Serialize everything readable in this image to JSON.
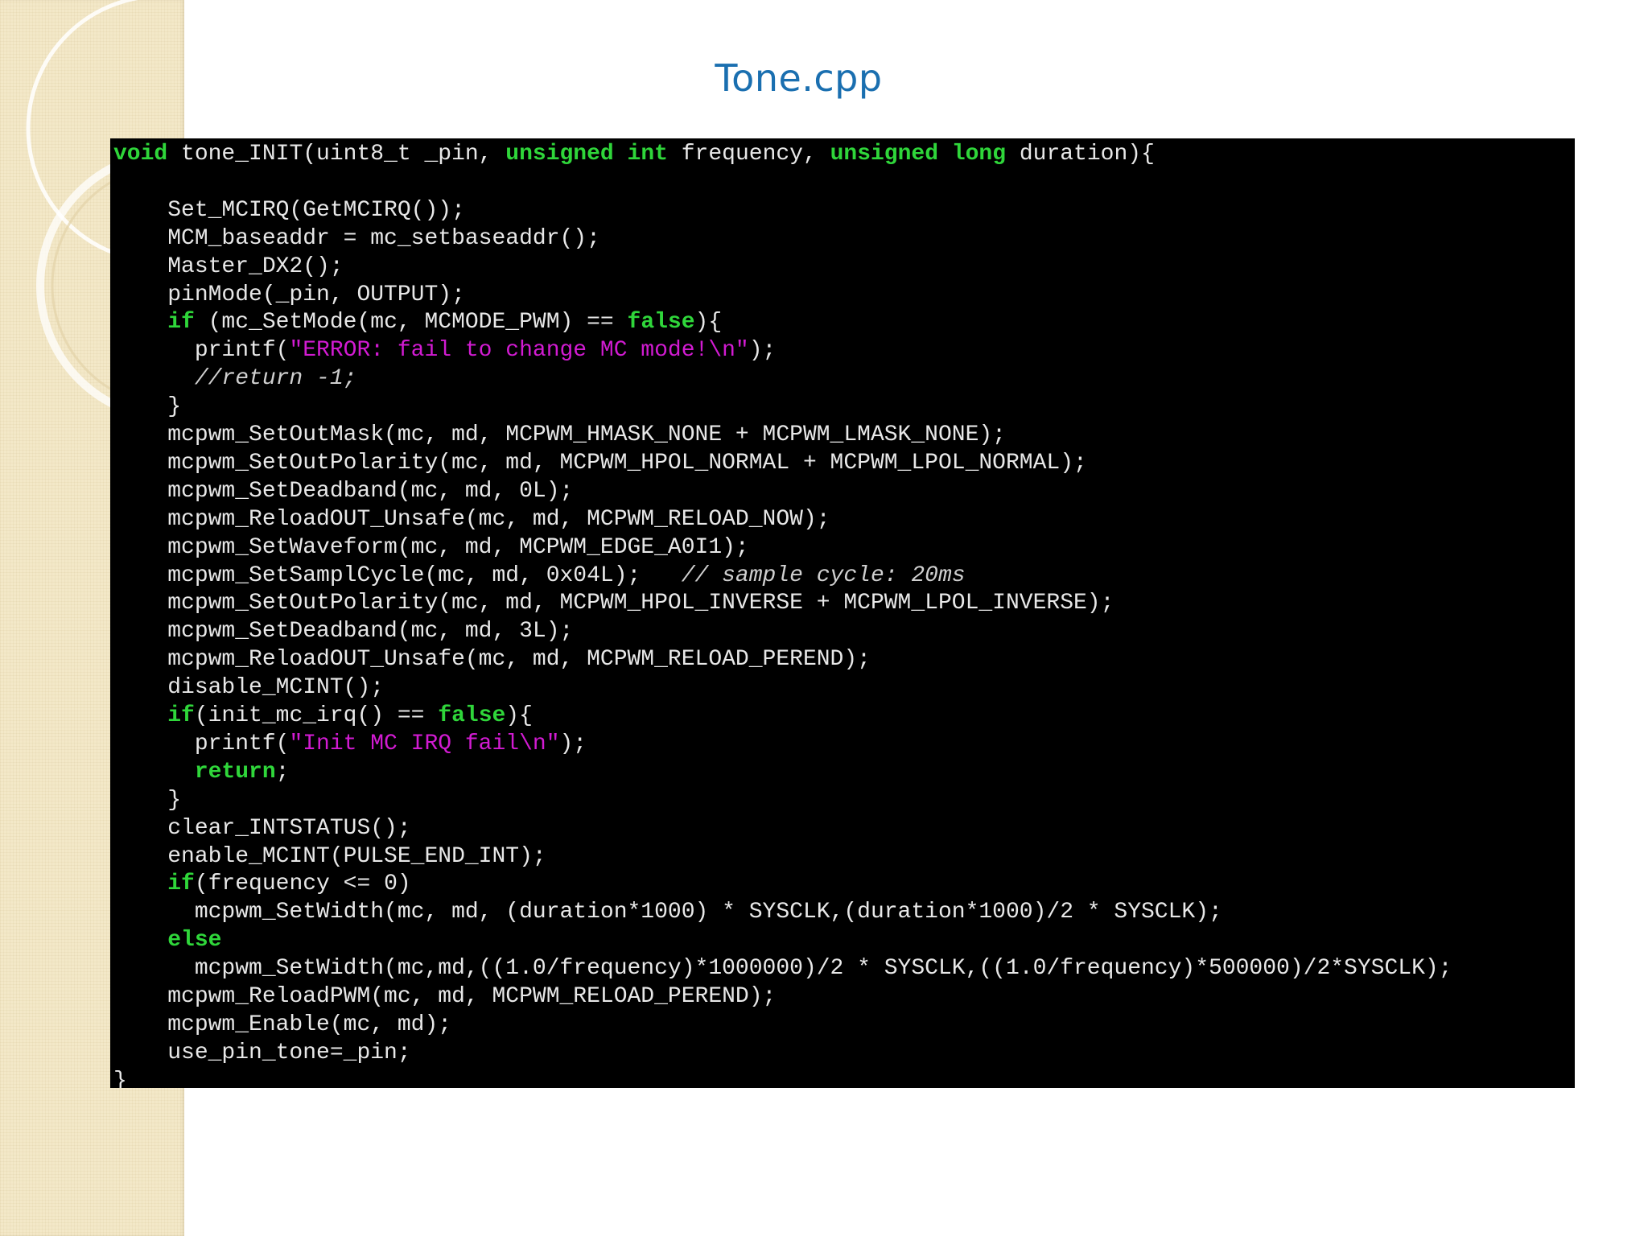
{
  "slide": {
    "title": "Tone.cpp"
  },
  "colors": {
    "title": "#1a6fb0",
    "code_background": "#000000",
    "code_text": "#e8e8e8",
    "keyword": "#2fd63a",
    "string": "#d21bd2",
    "comment": "#cfcfcf",
    "side_band": "#f3e8c8"
  },
  "code": {
    "language": "cpp",
    "lines": [
      [
        {
          "t": "void",
          "c": "kw"
        },
        {
          "t": " tone_INIT(uint8_t _pin, ",
          "c": "plain"
        },
        {
          "t": "unsigned",
          "c": "kw"
        },
        {
          "t": " ",
          "c": "plain"
        },
        {
          "t": "int",
          "c": "kw"
        },
        {
          "t": " frequency, ",
          "c": "plain"
        },
        {
          "t": "unsigned",
          "c": "kw"
        },
        {
          "t": " ",
          "c": "plain"
        },
        {
          "t": "long",
          "c": "kw"
        },
        {
          "t": " duration){",
          "c": "plain"
        }
      ],
      [],
      [
        {
          "t": "    Set_MCIRQ(GetMCIRQ());",
          "c": "plain"
        }
      ],
      [
        {
          "t": "    MCM_baseaddr = mc_setbaseaddr();",
          "c": "plain"
        }
      ],
      [
        {
          "t": "    Master_DX2();",
          "c": "plain"
        }
      ],
      [
        {
          "t": "    pinMode(_pin, OUTPUT);",
          "c": "plain"
        }
      ],
      [
        {
          "t": "    ",
          "c": "plain"
        },
        {
          "t": "if",
          "c": "kw"
        },
        {
          "t": " (mc_SetMode(mc, MCMODE_PWM) == ",
          "c": "plain"
        },
        {
          "t": "false",
          "c": "kw"
        },
        {
          "t": "){",
          "c": "plain"
        }
      ],
      [
        {
          "t": "      printf(",
          "c": "plain"
        },
        {
          "t": "\"ERROR: fail to change MC mode!\\n\"",
          "c": "str"
        },
        {
          "t": ");",
          "c": "plain"
        }
      ],
      [
        {
          "t": "      //return -1;",
          "c": "cmt"
        }
      ],
      [
        {
          "t": "    }",
          "c": "plain"
        }
      ],
      [
        {
          "t": "    mcpwm_SetOutMask(mc, md, MCPWM_HMASK_NONE + MCPWM_LMASK_NONE);",
          "c": "plain"
        }
      ],
      [
        {
          "t": "    mcpwm_SetOutPolarity(mc, md, MCPWM_HPOL_NORMAL + MCPWM_LPOL_NORMAL);",
          "c": "plain"
        }
      ],
      [
        {
          "t": "    mcpwm_SetDeadband(mc, md, 0L);",
          "c": "plain"
        }
      ],
      [
        {
          "t": "    mcpwm_ReloadOUT_Unsafe(mc, md, MCPWM_RELOAD_NOW);",
          "c": "plain"
        }
      ],
      [
        {
          "t": "    mcpwm_SetWaveform(mc, md, MCPWM_EDGE_A0I1);",
          "c": "plain"
        }
      ],
      [
        {
          "t": "    mcpwm_SetSamplCycle(mc, md, 0x04L);   ",
          "c": "plain"
        },
        {
          "t": "// sample cycle: 20ms",
          "c": "cmt"
        }
      ],
      [
        {
          "t": "    mcpwm_SetOutPolarity(mc, md, MCPWM_HPOL_INVERSE + MCPWM_LPOL_INVERSE);",
          "c": "plain"
        }
      ],
      [
        {
          "t": "    mcpwm_SetDeadband(mc, md, 3L);",
          "c": "plain"
        }
      ],
      [
        {
          "t": "    mcpwm_ReloadOUT_Unsafe(mc, md, MCPWM_RELOAD_PEREND);",
          "c": "plain"
        }
      ],
      [
        {
          "t": "    disable_MCINT();",
          "c": "plain"
        }
      ],
      [
        {
          "t": "    ",
          "c": "plain"
        },
        {
          "t": "if",
          "c": "kw"
        },
        {
          "t": "(init_mc_irq() == ",
          "c": "plain"
        },
        {
          "t": "false",
          "c": "kw"
        },
        {
          "t": "){",
          "c": "plain"
        }
      ],
      [
        {
          "t": "      printf(",
          "c": "plain"
        },
        {
          "t": "\"Init MC IRQ fail\\n\"",
          "c": "str"
        },
        {
          "t": ");",
          "c": "plain"
        }
      ],
      [
        {
          "t": "      ",
          "c": "plain"
        },
        {
          "t": "return",
          "c": "kw"
        },
        {
          "t": ";",
          "c": "plain"
        }
      ],
      [
        {
          "t": "    }",
          "c": "plain"
        }
      ],
      [
        {
          "t": "    clear_INTSTATUS();",
          "c": "plain"
        }
      ],
      [
        {
          "t": "    enable_MCINT(PULSE_END_INT);",
          "c": "plain"
        }
      ],
      [
        {
          "t": "    ",
          "c": "plain"
        },
        {
          "t": "if",
          "c": "kw"
        },
        {
          "t": "(frequency <= 0)",
          "c": "plain"
        }
      ],
      [
        {
          "t": "      mcpwm_SetWidth(mc, md, (duration*1000) * SYSCLK,(duration*1000)/2 * SYSCLK);",
          "c": "plain"
        }
      ],
      [
        {
          "t": "    ",
          "c": "plain"
        },
        {
          "t": "else",
          "c": "kw"
        }
      ],
      [
        {
          "t": "      mcpwm_SetWidth(mc,md,((1.0/frequency)*1000000)/2 * SYSCLK,((1.0/frequency)*500000)/2*SYSCLK);",
          "c": "plain"
        }
      ],
      [
        {
          "t": "    mcpwm_ReloadPWM(mc, md, MCPWM_RELOAD_PEREND);",
          "c": "plain"
        }
      ],
      [
        {
          "t": "    mcpwm_Enable(mc, md);",
          "c": "plain"
        }
      ],
      [
        {
          "t": "    use_pin_tone=_pin;",
          "c": "plain"
        }
      ],
      [
        {
          "t": "}",
          "c": "plain"
        }
      ]
    ]
  }
}
